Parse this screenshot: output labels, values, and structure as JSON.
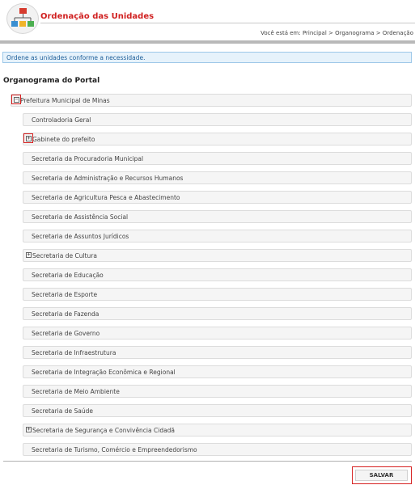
{
  "header": {
    "title": "Ordenação das Unidades",
    "breadcrumb": "Você está em: Principal > Organograma > Ordenação"
  },
  "info_message": "Ordene as unidades conforme a necessidade.",
  "section_title": "Organograma do Portal",
  "root": {
    "label": "Prefeitura Municipal de Minas",
    "toggle": "−",
    "expanded": true
  },
  "children": [
    {
      "label": "Controladoria Geral",
      "toggle": ""
    },
    {
      "label": "Gabinete do prefeito",
      "toggle": "+"
    },
    {
      "label": "Secretaria da Procuradoria Municipal",
      "toggle": ""
    },
    {
      "label": "Secretaria de Administração e Recursos Humanos",
      "toggle": ""
    },
    {
      "label": "Secretaria de Agricultura Pesca e Abastecimento",
      "toggle": ""
    },
    {
      "label": "Secretaria de Assistência Social",
      "toggle": ""
    },
    {
      "label": "Secretaria de Assuntos Jurídicos",
      "toggle": ""
    },
    {
      "label": "Secretaria de Cultura",
      "toggle": "+"
    },
    {
      "label": "Secretaria de Educação",
      "toggle": ""
    },
    {
      "label": "Secretaria de Esporte",
      "toggle": ""
    },
    {
      "label": "Secretaria de Fazenda",
      "toggle": ""
    },
    {
      "label": "Secretaria de Governo",
      "toggle": ""
    },
    {
      "label": "Secretaria de Infraestrutura",
      "toggle": ""
    },
    {
      "label": "Secretaria de Integração Econômica e Regional",
      "toggle": ""
    },
    {
      "label": "Secretaria de Meio Ambiente",
      "toggle": ""
    },
    {
      "label": "Secretaria de Saúde",
      "toggle": ""
    },
    {
      "label": "Secretaria de Segurança e Convivência Cidadã",
      "toggle": "+"
    },
    {
      "label": "Secretaria de Turismo, Comércio e Empreendedorismo",
      "toggle": ""
    }
  ],
  "save_label": "SALVAR",
  "colors": {
    "title": "#d02020",
    "highlight": "#d62020",
    "info_bg": "#e6f2fb",
    "info_text": "#1f5f99"
  }
}
